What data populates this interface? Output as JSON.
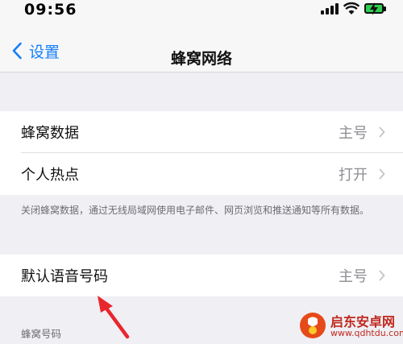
{
  "status_bar": {
    "time": "09:56"
  },
  "nav": {
    "back_label": "设置",
    "title": "蜂窝网络"
  },
  "group1": {
    "items": [
      {
        "label": "蜂窝数据",
        "value": "主号"
      },
      {
        "label": "个人热点",
        "value": "打开"
      }
    ]
  },
  "footnote": "关闭蜂窝数据，通过无线局域网使用电子邮件、网页浏览和推送通知等所有数据。",
  "group2": {
    "items": [
      {
        "label": "默认语音号码",
        "value": "主号"
      }
    ]
  },
  "section_header": "蜂窝号码",
  "watermark": {
    "title": "启东安卓网",
    "url": "www.qdhtdu.com"
  },
  "colors": {
    "accent": "#147efb",
    "annotation_arrow": "#e8262e",
    "battery": "#2fce50",
    "watermark": "#c0281e"
  }
}
